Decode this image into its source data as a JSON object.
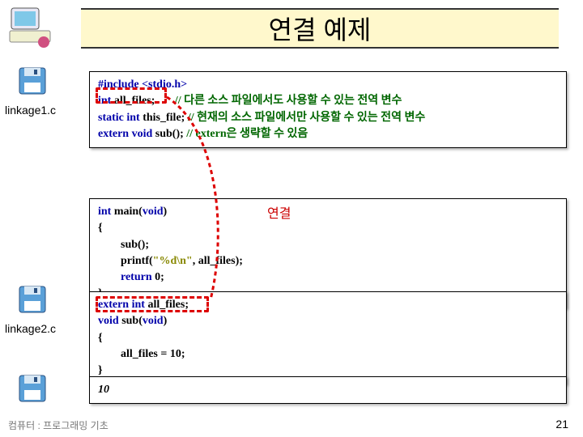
{
  "header": {
    "title": "연결 예제"
  },
  "files": {
    "linkage1": "linkage1.c",
    "linkage2": "linkage2.c"
  },
  "code1": {
    "l1": {
      "a": "#include <stdio.h>"
    },
    "l2": {
      "a": "int",
      "b": " all_files;",
      "c": "// 다른 소스 파일에서도 사용할 수 있는 전역 변수"
    },
    "l3": {
      "a": "static int",
      "b": " this_file; ",
      "c": "// 현재의 소스 파일에서만 사용할 수 있는 전역 변수"
    },
    "l4": {
      "a": "extern void",
      "b": " sub();   ",
      "c": "// extern은 생략할 수 있음"
    }
  },
  "code2": {
    "l1": {
      "a": "int",
      "b": " main(",
      "c": "void",
      "d": ")"
    },
    "l2": "{",
    "l3": "        sub();",
    "l4a": "        printf(",
    "l4b": "\"%d\\n\"",
    "l4c": ", all_files);",
    "l5a": "        ",
    "l5b": "return",
    "l5c": " 0;",
    "l6": "}"
  },
  "code3": {
    "l1": {
      "a": "extern int",
      "b": " all_files;"
    },
    "l2": {
      "a": "void",
      "b": " sub(",
      "c": "void",
      "d": ")"
    },
    "l3": "{",
    "l4": "        all_files = 10;",
    "l5": "}"
  },
  "code4": {
    "out": "10"
  },
  "link_label": "연결",
  "footer": "컴퓨터 : 프로그래밍 기초",
  "page": "21"
}
